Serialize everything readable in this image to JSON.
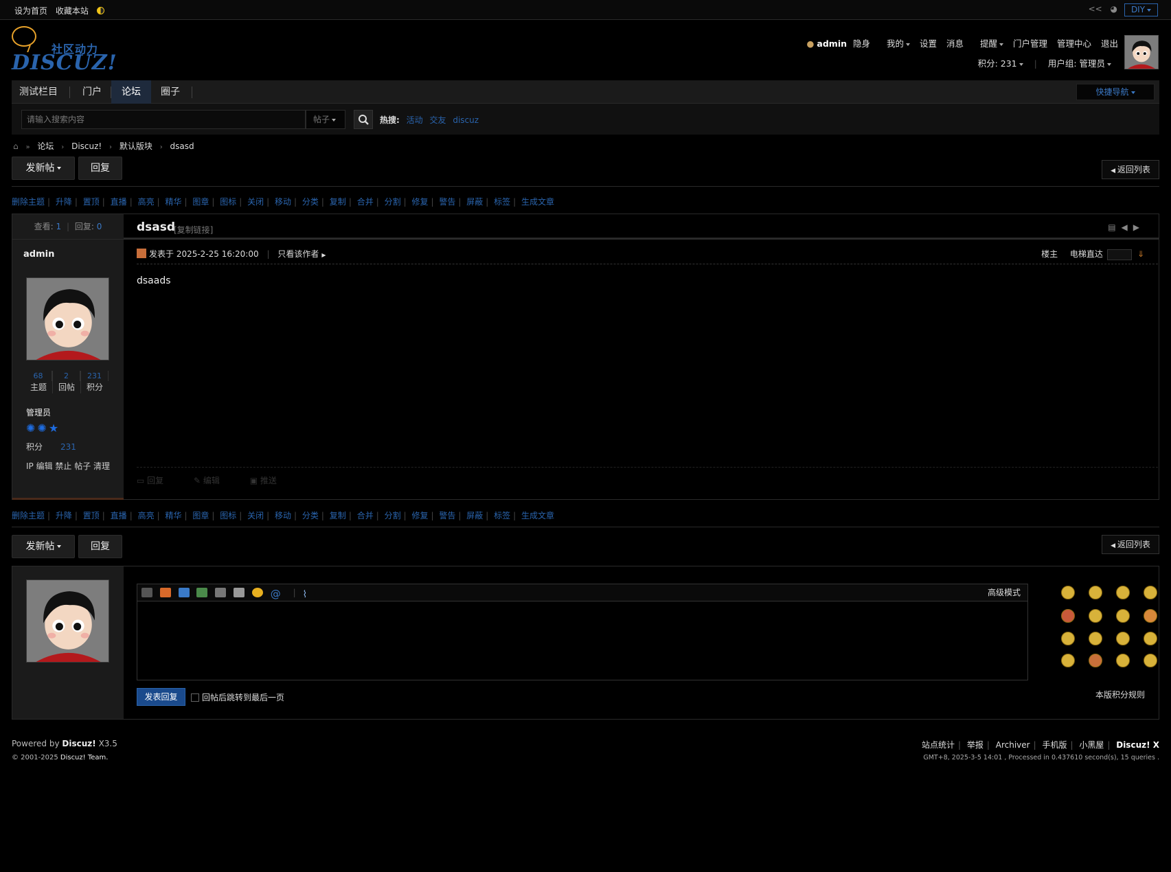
{
  "topbar": {
    "set_home": "设为首页",
    "bookmark": "收藏本站",
    "diy": "DIY"
  },
  "logo": {
    "cn": "社区动力",
    "en": "DISCUZ!"
  },
  "user": {
    "name": "admin",
    "invisible": "隐身",
    "my": "我的",
    "settings": "设置",
    "messages": "消息",
    "remind": "提醒",
    "portal_admin": "门户管理",
    "admin_center": "管理中心",
    "logout": "退出",
    "credits": "积分: 231",
    "usergroup": "用户组: 管理员"
  },
  "nav": {
    "items": [
      "测试栏目",
      "门户",
      "论坛",
      "圈子"
    ],
    "active": "论坛",
    "quick_nav": "快捷导航"
  },
  "search": {
    "placeholder": "请输入搜索内容",
    "type": "帖子",
    "hot_label": "热搜:",
    "hot_terms": [
      "活动",
      "交友",
      "discuz"
    ]
  },
  "breadcrumb": [
    "论坛",
    "Discuz!",
    "默认版块",
    "dsasd"
  ],
  "buttons": {
    "new_thread": "发新帖",
    "reply": "回复",
    "back_list": "返回列表"
  },
  "mod_actions": [
    "删除主题",
    "升降",
    "置顶",
    "直播",
    "高亮",
    "精华",
    "图章",
    "图标",
    "关闭",
    "移动",
    "分类",
    "复制",
    "合并",
    "分割",
    "修复",
    "警告",
    "屏蔽",
    "标签",
    "生成文章"
  ],
  "thread": {
    "views_label": "查看:",
    "views": "1",
    "replies_label": "回复:",
    "replies": "0",
    "title": "dsasd",
    "copy_link": "[复制链接]"
  },
  "post": {
    "author": "admin",
    "stats": [
      {
        "n": "68",
        "l": "主题"
      },
      {
        "n": "2",
        "l": "回帖"
      },
      {
        "n": "231",
        "l": "积分"
      }
    ],
    "group": "管理员",
    "credit_label": "积分",
    "credit_value": "231",
    "admin_ops": "IP 编辑 禁止 帖子 清理",
    "posted_at": "发表于 2025-2-25 16:20:00",
    "only_author": "只看该作者",
    "floor": "楼主",
    "elevator": "电梯直达",
    "content": "dsaads",
    "foot_actions": [
      "回复",
      "编辑",
      "推送"
    ]
  },
  "reply_box": {
    "advanced": "高级模式",
    "submit": "发表回复",
    "jump_label": "回帖后跳转到最后一页",
    "rules": "本版积分规则"
  },
  "footer": {
    "powered": "Powered by",
    "brand": "Discuz!",
    "version": "X3.5",
    "copyright_pre": "© 2001-2025",
    "copyright_brand": "Discuz! Team.",
    "links": [
      "站点统计",
      "举报",
      "Archiver",
      "手机版",
      "小黑屋",
      "Discuz! X"
    ],
    "stats": "GMT+8, 2025-3-5 14:01 , Processed in 0.437610 second(s), 15 queries ."
  }
}
